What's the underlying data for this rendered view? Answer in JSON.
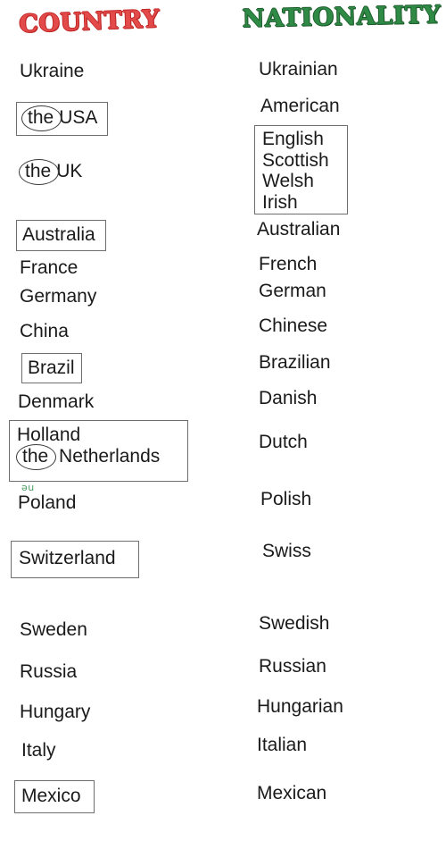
{
  "headers": {
    "country": "COUNTRY",
    "nationality": "NATIONALITY",
    "country_color": "#e34a4a",
    "nationality_color": "#2f8a46"
  },
  "article": {
    "the": "the"
  },
  "annotations": {
    "poland_phonetic": "әu",
    "poland_phonetic_color": "#4b9e62"
  },
  "country_column": {
    "ukraine": "Ukraine",
    "usa": "USA",
    "uk": "UK",
    "australia": "Australia",
    "france": "France",
    "germany": "Germany",
    "china": "China",
    "brazil": "Brazil",
    "denmark": "Denmark",
    "holland": "Holland",
    "netherlands": "Netherlands",
    "poland": "Poland",
    "switzerland": "Switzerland",
    "sweden": "Sweden",
    "russia": "Russia",
    "hungary": "Hungary",
    "italy": "Italy",
    "mexico": "Mexico"
  },
  "nationality_column": {
    "ukrainian": "Ukrainian",
    "american": "American",
    "english": "English",
    "scottish": "Scottish",
    "welsh": "Welsh",
    "irish": "Irish",
    "australian": "Australian",
    "french": "French",
    "german": "German",
    "chinese": "Chinese",
    "brazilian": "Brazilian",
    "danish": "Danish",
    "dutch": "Dutch",
    "polish": "Polish",
    "swiss": "Swiss",
    "swedish": "Swedish",
    "russian": "Russian",
    "hungarian": "Hungarian",
    "italian": "Italian",
    "mexican": "Mexican"
  }
}
